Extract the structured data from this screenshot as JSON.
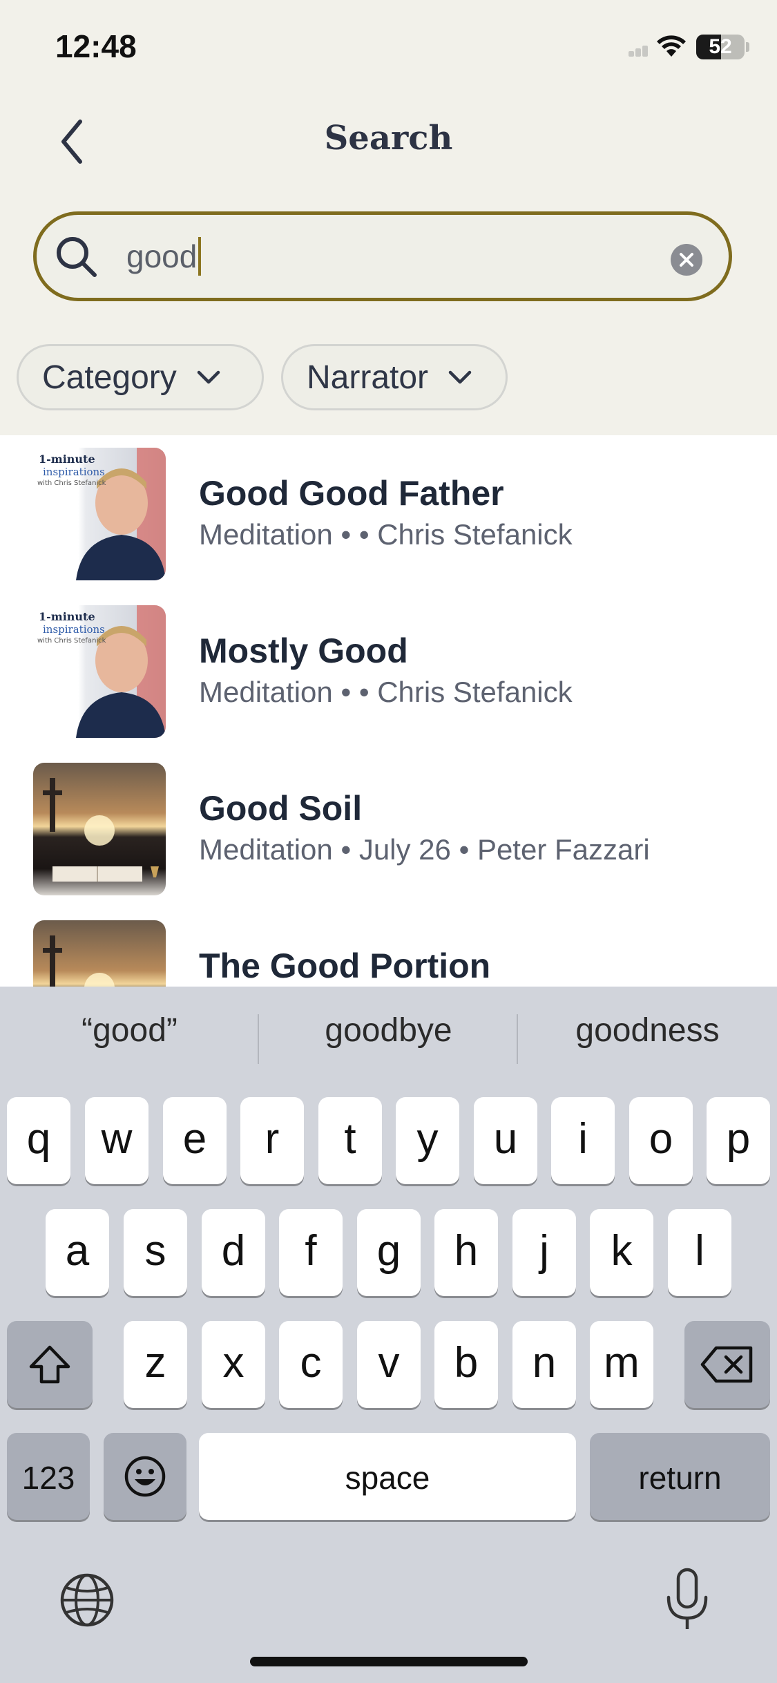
{
  "status_bar": {
    "time": "12:48",
    "battery": "52"
  },
  "header": {
    "title": "Search",
    "back_icon": "chevron-left-icon"
  },
  "search": {
    "value": "good",
    "placeholder": "",
    "accent_color": "#7f6c1e"
  },
  "filters": [
    {
      "label": "Category"
    },
    {
      "label": "Narrator"
    }
  ],
  "results": [
    {
      "title": "Good Good Father",
      "subtitle": "Meditation •  • Chris Stefanick",
      "thumb_caption_1": "1-minute",
      "thumb_caption_2": "inspirations",
      "thumb_caption_3": "with Chris Stefanick"
    },
    {
      "title": "Mostly Good",
      "subtitle": "Meditation •  • Chris Stefanick",
      "thumb_caption_1": "1-minute",
      "thumb_caption_2": "inspirations",
      "thumb_caption_3": "with Chris Stefanick"
    },
    {
      "title": "Good Soil",
      "subtitle": "Meditation • July 26 • Peter Fazzari"
    },
    {
      "title": "The Good Portion",
      "subtitle": ""
    }
  ],
  "keyboard": {
    "suggestions": [
      "“good”",
      "goodbye",
      "goodness"
    ],
    "row1": [
      "q",
      "w",
      "e",
      "r",
      "t",
      "y",
      "u",
      "i",
      "o",
      "p"
    ],
    "row2": [
      "a",
      "s",
      "d",
      "f",
      "g",
      "h",
      "j",
      "k",
      "l"
    ],
    "row3": [
      "z",
      "x",
      "c",
      "v",
      "b",
      "n",
      "m"
    ],
    "numbers_label": "123",
    "space_label": "space",
    "return_label": "return"
  }
}
